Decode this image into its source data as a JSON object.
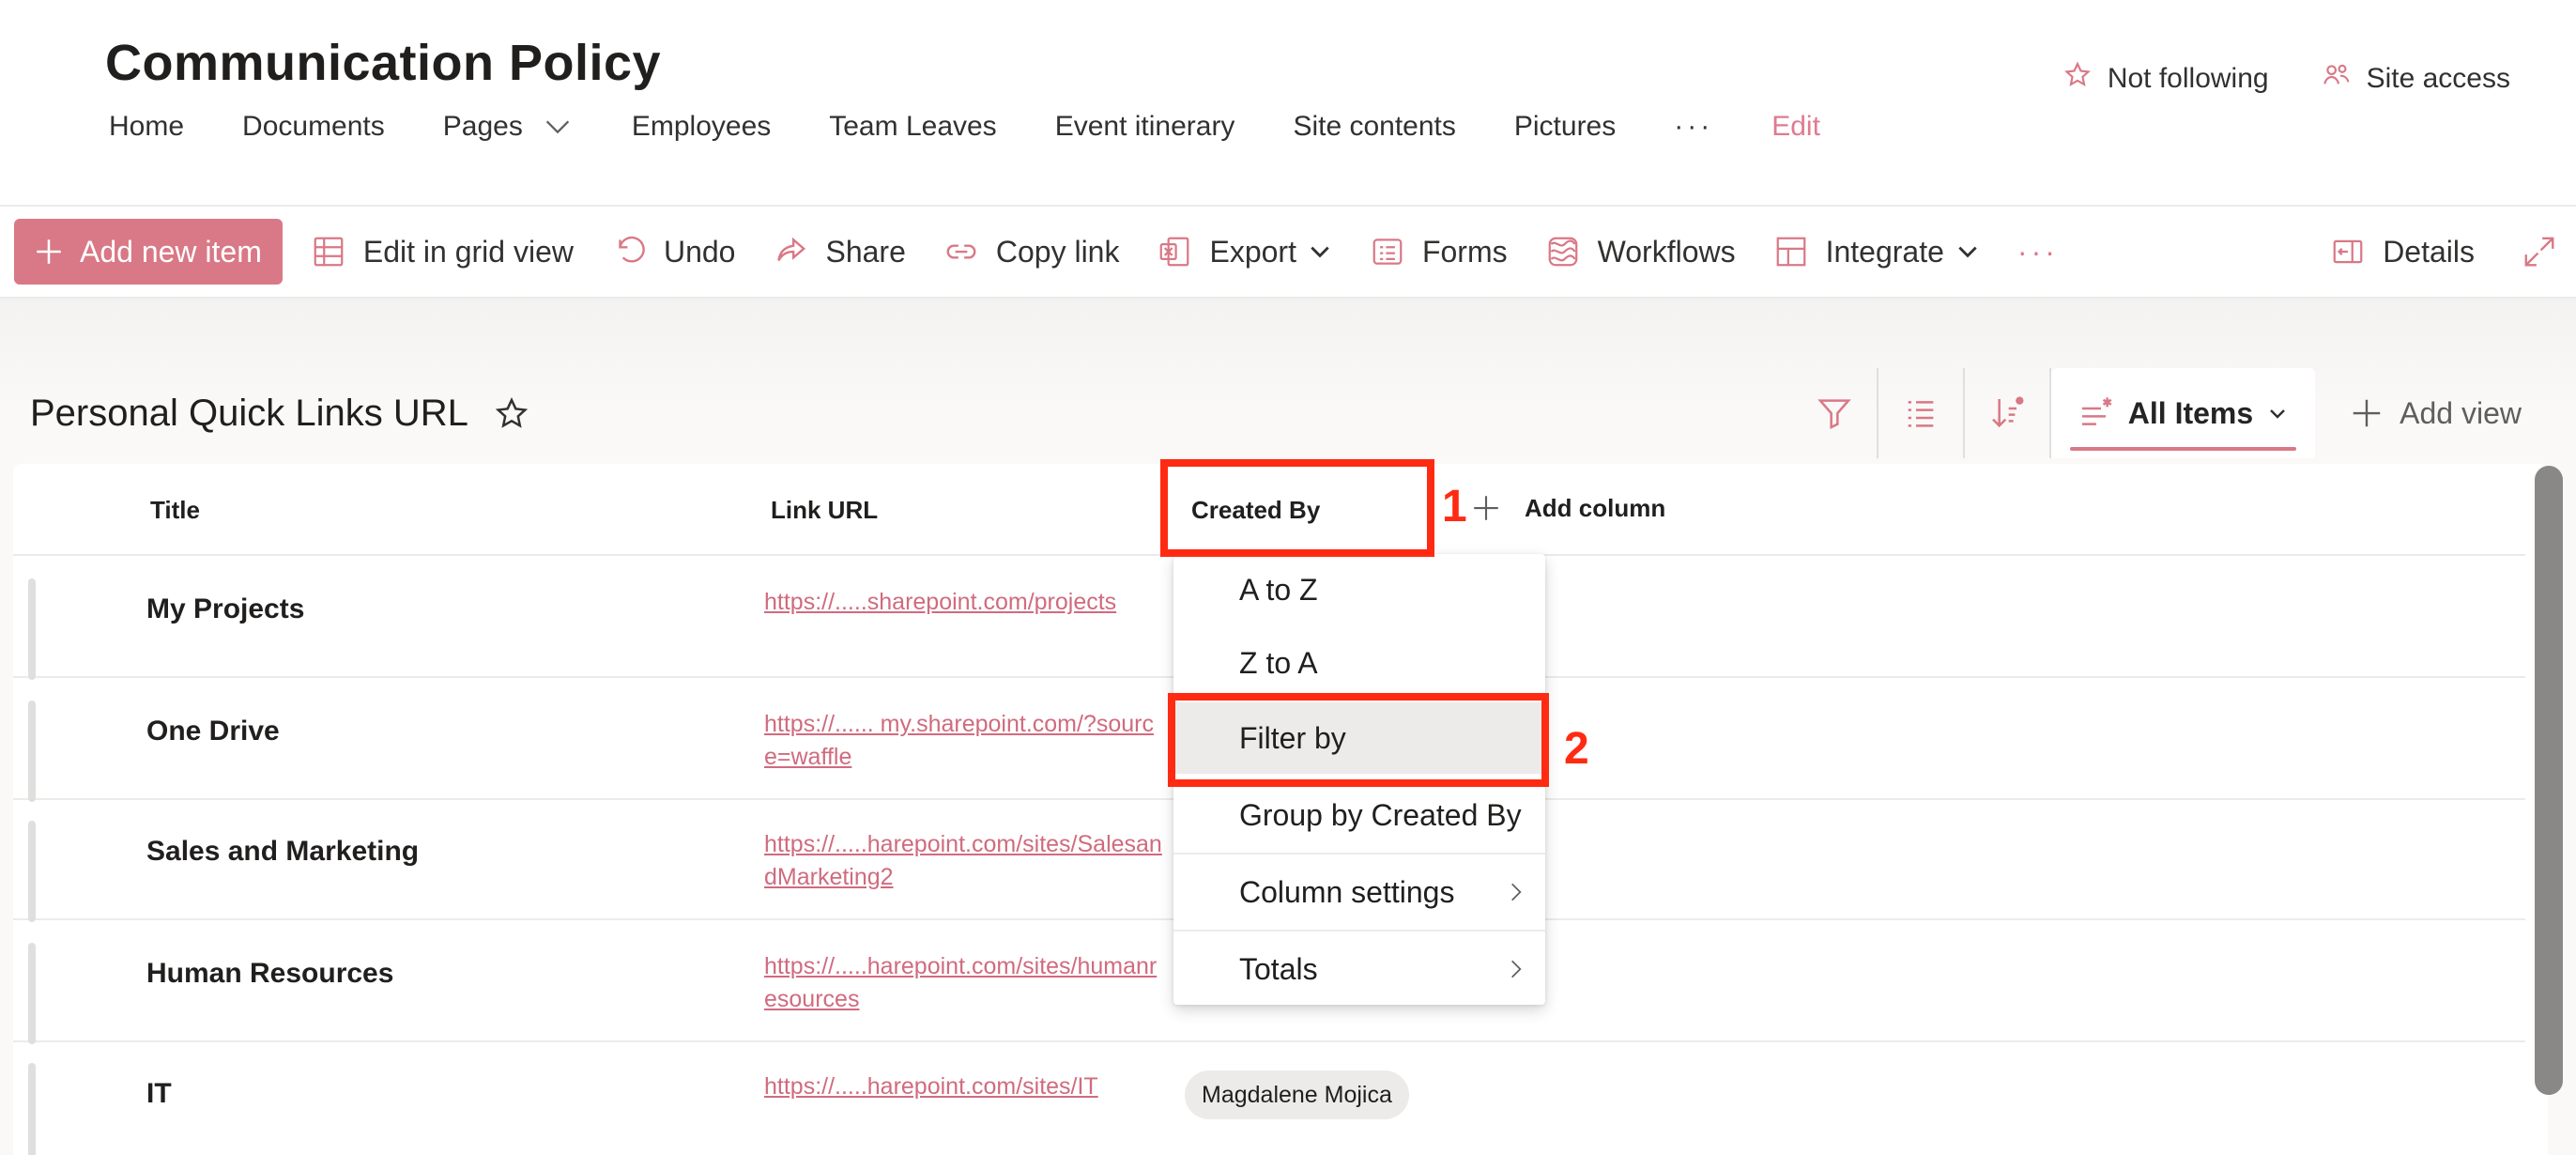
{
  "header": {
    "site_title": "Communication Policy",
    "follow_label": "Not following",
    "site_access_label": "Site access",
    "nav": [
      {
        "label": "Home"
      },
      {
        "label": "Documents"
      },
      {
        "label": "Pages"
      },
      {
        "label": "Employees"
      },
      {
        "label": "Team Leaves"
      },
      {
        "label": "Event itinerary"
      },
      {
        "label": "Site contents"
      },
      {
        "label": "Pictures"
      },
      {
        "label": "···"
      },
      {
        "label": "Edit"
      }
    ]
  },
  "command_bar": {
    "add_new_item": "Add new item",
    "edit_grid": "Edit in grid view",
    "undo": "Undo",
    "share": "Share",
    "copy_link": "Copy link",
    "export": "Export",
    "forms": "Forms",
    "workflows": "Workflows",
    "integrate": "Integrate",
    "more": "···",
    "details": "Details"
  },
  "list": {
    "title": "Personal Quick Links URL",
    "current_view": "All Items",
    "add_view": "Add view",
    "columns": {
      "title": "Title",
      "link_url": "Link URL",
      "created_by": "Created By",
      "add_column": "Add column"
    },
    "rows": [
      {
        "title": "My Projects",
        "link": "https://.....sharepoint.com/projects",
        "created_by": ""
      },
      {
        "title": "One Drive",
        "link": "https://...... my.sharepoint.com/?source=waffle",
        "created_by": ""
      },
      {
        "title": "Sales and Marketing",
        "link": "https://.....harepoint.com/sites/SalesandMarketing2",
        "created_by": ""
      },
      {
        "title": "Human Resources",
        "link": "https://.....harepoint.com/sites/humanresources",
        "created_by": ""
      },
      {
        "title": "IT",
        "link": "https://.....harepoint.com/sites/IT",
        "created_by": "Magdalene Mojica"
      }
    ]
  },
  "column_menu": {
    "items": [
      {
        "label": "A to Z"
      },
      {
        "label": "Z to A"
      },
      {
        "label": "Filter by"
      },
      {
        "label": "Group by Created By"
      },
      {
        "label": "Column settings"
      },
      {
        "label": "Totals"
      }
    ]
  },
  "annotations": {
    "step1": "1",
    "step2": "2",
    "color": "#ff2a12"
  },
  "theme": {
    "accent": "#d97886",
    "link": "#d06b7e"
  }
}
